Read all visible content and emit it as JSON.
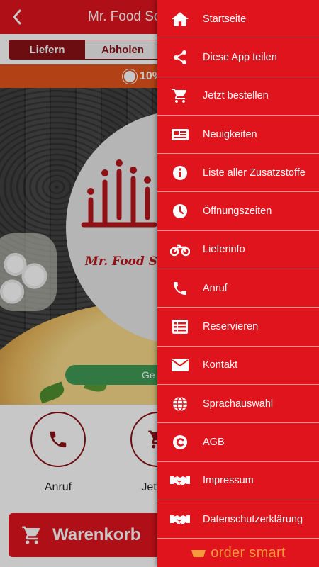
{
  "app": {
    "title": "Mr. Food Sch",
    "segments": [
      {
        "label": "Liefern",
        "active": true
      },
      {
        "label": "Abholen",
        "active": false
      }
    ],
    "promo_text": "10%",
    "logo_text": "Mr. Food Sch",
    "open_pill": "Ge",
    "actions": [
      {
        "label": "Anruf",
        "icon": "phone-icon"
      },
      {
        "label": "Jetzt b",
        "icon": "cart-icon"
      }
    ],
    "cart_label": "Warenkorb"
  },
  "drawer": {
    "items": [
      {
        "label": "Startseite",
        "icon": "home-icon"
      },
      {
        "label": "Diese App teilen",
        "icon": "share-icon"
      },
      {
        "label": "Jetzt bestellen",
        "icon": "cart-icon"
      },
      {
        "label": "Neuigkeiten",
        "icon": "newspaper-icon"
      },
      {
        "label": "Liste aller Zusatzstoffe",
        "icon": "info-icon"
      },
      {
        "label": "Öffnungszeiten",
        "icon": "clock-icon"
      },
      {
        "label": "Lieferinfo",
        "icon": "motorcycle-icon"
      },
      {
        "label": "Anruf",
        "icon": "phone-icon"
      },
      {
        "label": "Reservieren",
        "icon": "list-icon"
      },
      {
        "label": "Kontakt",
        "icon": "envelope-icon"
      },
      {
        "label": "Sprachauswahl",
        "icon": "globe-icon"
      },
      {
        "label": "AGB",
        "icon": "copyright-icon"
      },
      {
        "label": "Impressum",
        "icon": "handshake-icon"
      },
      {
        "label": "Datenschutzerklärung",
        "icon": "handshake-icon"
      }
    ],
    "footer_brand": "order smart"
  },
  "colors": {
    "primary": "#e0141d",
    "dark_red": "#8b1116",
    "promo_orange": "#e4541c",
    "open_green": "#3f9a55",
    "brand_orange": "#f59a3a"
  }
}
